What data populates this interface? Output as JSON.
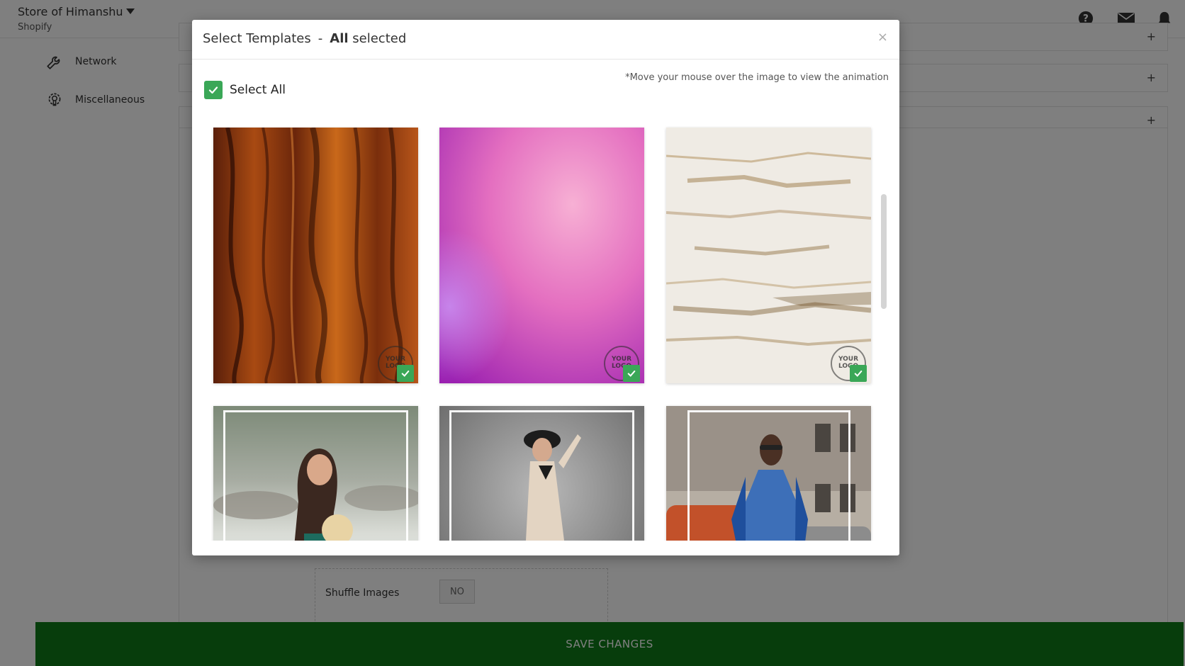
{
  "header": {
    "store_name": "Store of Himanshu",
    "platform": "Shopify",
    "icons": [
      "help-icon",
      "mail-icon",
      "bell-icon"
    ]
  },
  "sidebar": {
    "items": [
      {
        "label": "Network",
        "icon": "wrench-icon"
      },
      {
        "label": "Miscellaneous",
        "icon": "gear-bulb-icon"
      }
    ]
  },
  "accordion": {
    "expand_symbol": "+"
  },
  "shuffle": {
    "label": "Shuffle Images",
    "value": "NO"
  },
  "save_bar": {
    "label": "SAVE CHANGES"
  },
  "modal": {
    "title": "Select Templates",
    "separator": "-",
    "count_strong": "All",
    "count_rest": " selected",
    "close_symbol": "×",
    "select_all_label": "Select All",
    "select_all_checked": true,
    "hint": "*Move your mouse over the image to view the animation",
    "logo_text": "YOUR LOGO",
    "templates": [
      {
        "name": "wood-grain-template",
        "selected": true
      },
      {
        "name": "pink-gradient-template",
        "selected": true
      },
      {
        "name": "rustic-white-texture-template",
        "selected": true
      },
      {
        "name": "beach-fashion-template",
        "selected": false
      },
      {
        "name": "studio-dress-template",
        "selected": false
      },
      {
        "name": "street-style-template",
        "selected": false
      }
    ]
  },
  "colors": {
    "accent_green": "#3aa757",
    "save_bar_green": "#0f7a18",
    "overlay": "rgba(0,0,0,0.5)"
  }
}
